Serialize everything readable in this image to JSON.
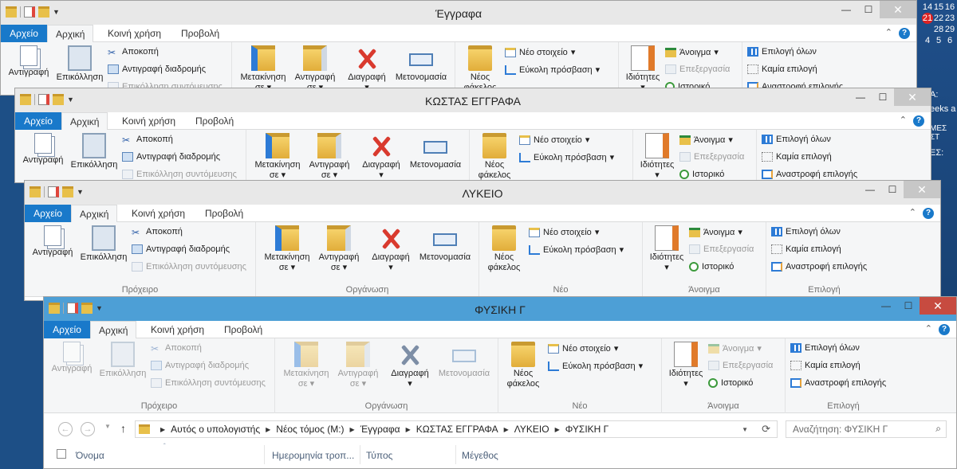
{
  "desktop": {
    "calendar_rows": [
      [
        "14",
        "15",
        "16"
      ],
      [
        "21",
        "22",
        "23"
      ],
      [
        "28",
        "29"
      ],
      [
        "4",
        "5",
        "6"
      ]
    ],
    "snippets": [
      "A:",
      "eeks a",
      "ΜΕΣ ΣΤ",
      "ΕΣ:"
    ]
  },
  "ribbon_common": {
    "tab_file": "Αρχείο",
    "tab_home": "Αρχική",
    "tab_share": "Κοινή χρήση",
    "tab_view": "Προβολή",
    "copy": "Αντιγραφή",
    "paste": "Επικόλληση",
    "cut": "Αποκοπή",
    "copy_path": "Αντιγραφή διαδρομής",
    "paste_shortcut": "Επικόλληση συντόμευσης",
    "move_to": "Μετακίνηση",
    "copy_to": "Αντιγραφή",
    "to": "σε",
    "delete": "Διαγραφή",
    "rename": "Μετονομασία",
    "new_folder": "Νέος",
    "folder": "φάκελος",
    "new_item": "Νέο στοιχείο",
    "easy_access": "Εύκολη πρόσβαση",
    "properties": "Ιδιότητες",
    "open": "Άνοιγμα",
    "edit": "Επεξεργασία",
    "history": "Ιστορικό",
    "select_all": "Επιλογή όλων",
    "select_none": "Καμία επιλογή",
    "invert_selection": "Αναστροφή επιλογής",
    "grp_clipboard": "Πρόχειρο",
    "grp_organize": "Οργάνωση",
    "grp_new": "Νέο",
    "grp_open": "Άνοιγμα",
    "grp_select": "Επιλογή"
  },
  "windows": [
    {
      "title": "Έγγραφα"
    },
    {
      "title": "ΚΩΣΤΑΣ ΕΓΓΡΑΦΑ"
    },
    {
      "title": "ΛΥΚΕΙΟ"
    },
    {
      "title": "ΦΥΣΙΚΗ Γ"
    }
  ],
  "address": {
    "crumbs": [
      "Αυτός ο υπολογιστής",
      "Νέος τόμος (M:)",
      "Έγγραφα",
      "ΚΩΣΤΑΣ ΕΓΓΡΑΦΑ",
      "ΛΥΚΕΙΟ",
      "ΦΥΣΙΚΗ Γ"
    ],
    "search_placeholder": "Αναζήτηση: ΦΥΣΙΚΗ Γ"
  },
  "columns": [
    "Όνομα",
    "Ημερομηνία τροπ...",
    "Τύπος",
    "Μέγεθος"
  ],
  "colors": {
    "file_tab": "#1979ca",
    "active_title": "#4d9fd6",
    "close_active": "#c74b40"
  },
  "icons": [
    "folder-icon",
    "document-icon",
    "copy-icon",
    "paste-icon",
    "scissors-icon",
    "move-icon",
    "delete-icon",
    "rename-icon",
    "properties-icon",
    "help-icon",
    "back-arrow-icon",
    "forward-arrow-icon",
    "up-arrow-icon",
    "refresh-icon",
    "search-icon"
  ]
}
